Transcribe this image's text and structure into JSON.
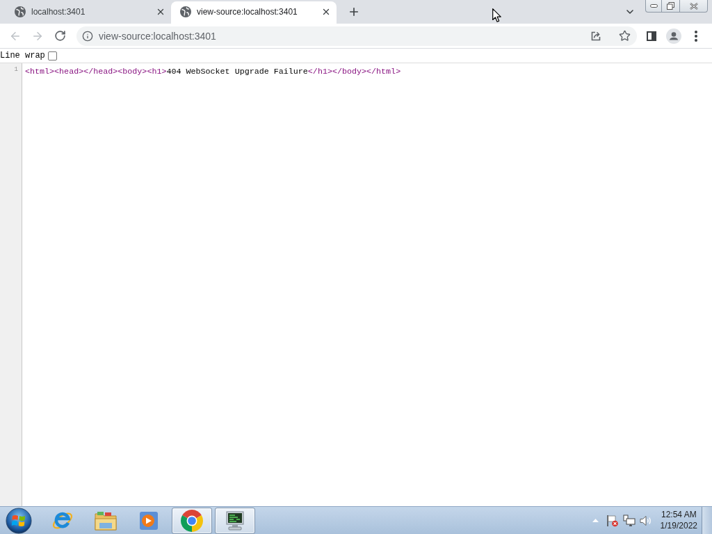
{
  "tabs": [
    {
      "title": "localhost:3401",
      "selected": false
    },
    {
      "title": "view-source:localhost:3401",
      "selected": true
    }
  ],
  "toolbar": {
    "nav": [
      {
        "kind": "back",
        "disabled": true
      },
      {
        "kind": "forward",
        "disabled": true
      },
      {
        "kind": "reload",
        "disabled": false
      }
    ],
    "address": {
      "value": "view-source:localhost:3401"
    }
  },
  "view_source": {
    "line_wrap": {
      "label": "Line wrap",
      "checked": false
    },
    "lines": [
      {
        "number": "1",
        "tokens": [
          {
            "kind": "tag",
            "text": "<html>"
          },
          {
            "kind": "tag",
            "text": "<head>"
          },
          {
            "kind": "tag",
            "text": "</head>"
          },
          {
            "kind": "tag",
            "text": "<body>"
          },
          {
            "kind": "tag",
            "text": "<h1>"
          },
          {
            "kind": "text",
            "text": "404 WebSocket Upgrade Failure"
          },
          {
            "kind": "tag",
            "text": "</h1>"
          },
          {
            "kind": "tag",
            "text": "</body>"
          },
          {
            "kind": "tag",
            "text": "</html>"
          }
        ]
      }
    ]
  },
  "taskbar": {
    "apps": [
      {
        "kind": "internet-explorer",
        "active": false
      },
      {
        "kind": "file-explorer",
        "active": false
      },
      {
        "kind": "media-player",
        "active": false
      },
      {
        "kind": "chrome",
        "active": true
      },
      {
        "kind": "system-monitor",
        "active": true
      }
    ],
    "clock": {
      "time": "12:54 AM",
      "date": "1/19/2022"
    }
  }
}
